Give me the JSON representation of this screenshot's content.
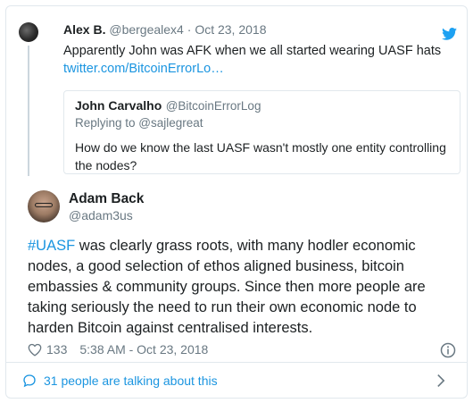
{
  "parent_tweet": {
    "name": "Alex B.",
    "handle": "@bergealex4",
    "separator": "·",
    "date": "Oct 23, 2018",
    "text": "Apparently John was AFK when we all started wearing UASF hats",
    "link": "twitter.com/BitcoinErrorLo…",
    "icon": "twitter-bird-icon"
  },
  "quoted_tweet": {
    "name": "John Carvalho",
    "handle": "@BitcoinErrorLog",
    "replying_to": "Replying to @sajlegreat",
    "text": "How do we know the last UASF wasn't mostly one entity controlling the nodes?"
  },
  "main_tweet": {
    "name": "Adam Back",
    "handle": "@adam3us",
    "hashtag": "#UASF",
    "text": " was clearly grass roots, with many hodler economic nodes, a good selection of ethos aligned business, bitcoin embassies & community groups. Since then more people are taking seriously the need to run their own economic node to harden Bitcoin against centralised interests.",
    "likes": "133",
    "timestamp": "5:38 AM - Oct 23, 2018"
  },
  "footer": {
    "talking_label": "31 people are talking about this"
  },
  "colors": {
    "accent": "#1b95e0",
    "muted": "#697882",
    "border": "#e1e8ed"
  }
}
